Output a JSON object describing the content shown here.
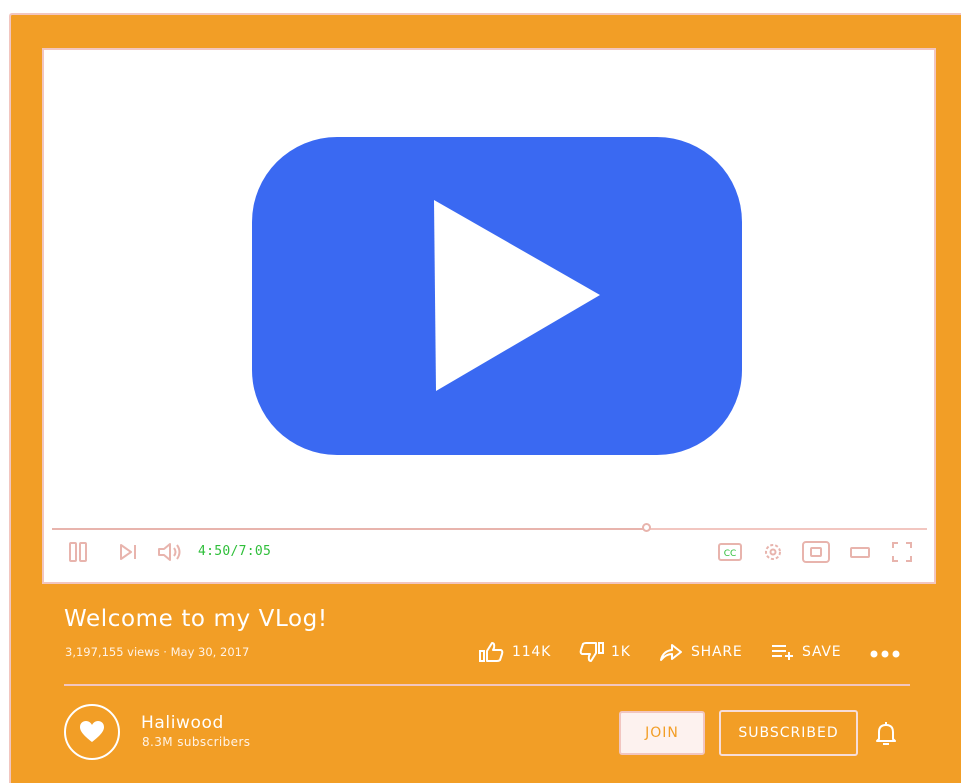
{
  "player": {
    "current_time": "4:50",
    "duration": "7:05",
    "time_display": "4:50/7:05",
    "progress_fraction": 0.68,
    "cc_label": "CC"
  },
  "video": {
    "title": "Welcome to my VLog!",
    "meta": "3,197,155 views · May 30, 2017"
  },
  "actions": {
    "like_count": "114K",
    "dislike_count": "1K",
    "share_label": "SHARE",
    "save_label": "SAVE"
  },
  "channel": {
    "name": "Haliwood",
    "subscribers": "8.3M subscribers",
    "join_label": "JOIN",
    "subscribed_label": "SUBSCRIBED"
  },
  "colors": {
    "background": "#f29e26",
    "play_button": "#3a69f2",
    "accent_line": "#f2c6c0",
    "time_text": "#2fbf3a"
  },
  "icons": [
    "play-icon",
    "pause-icon",
    "next-icon",
    "volume-icon",
    "captions-icon",
    "settings-icon",
    "miniplayer-icon",
    "theater-icon",
    "fullscreen-icon",
    "like-icon",
    "dislike-icon",
    "share-icon",
    "save-icon",
    "more-icon",
    "heart-icon",
    "bell-icon"
  ]
}
